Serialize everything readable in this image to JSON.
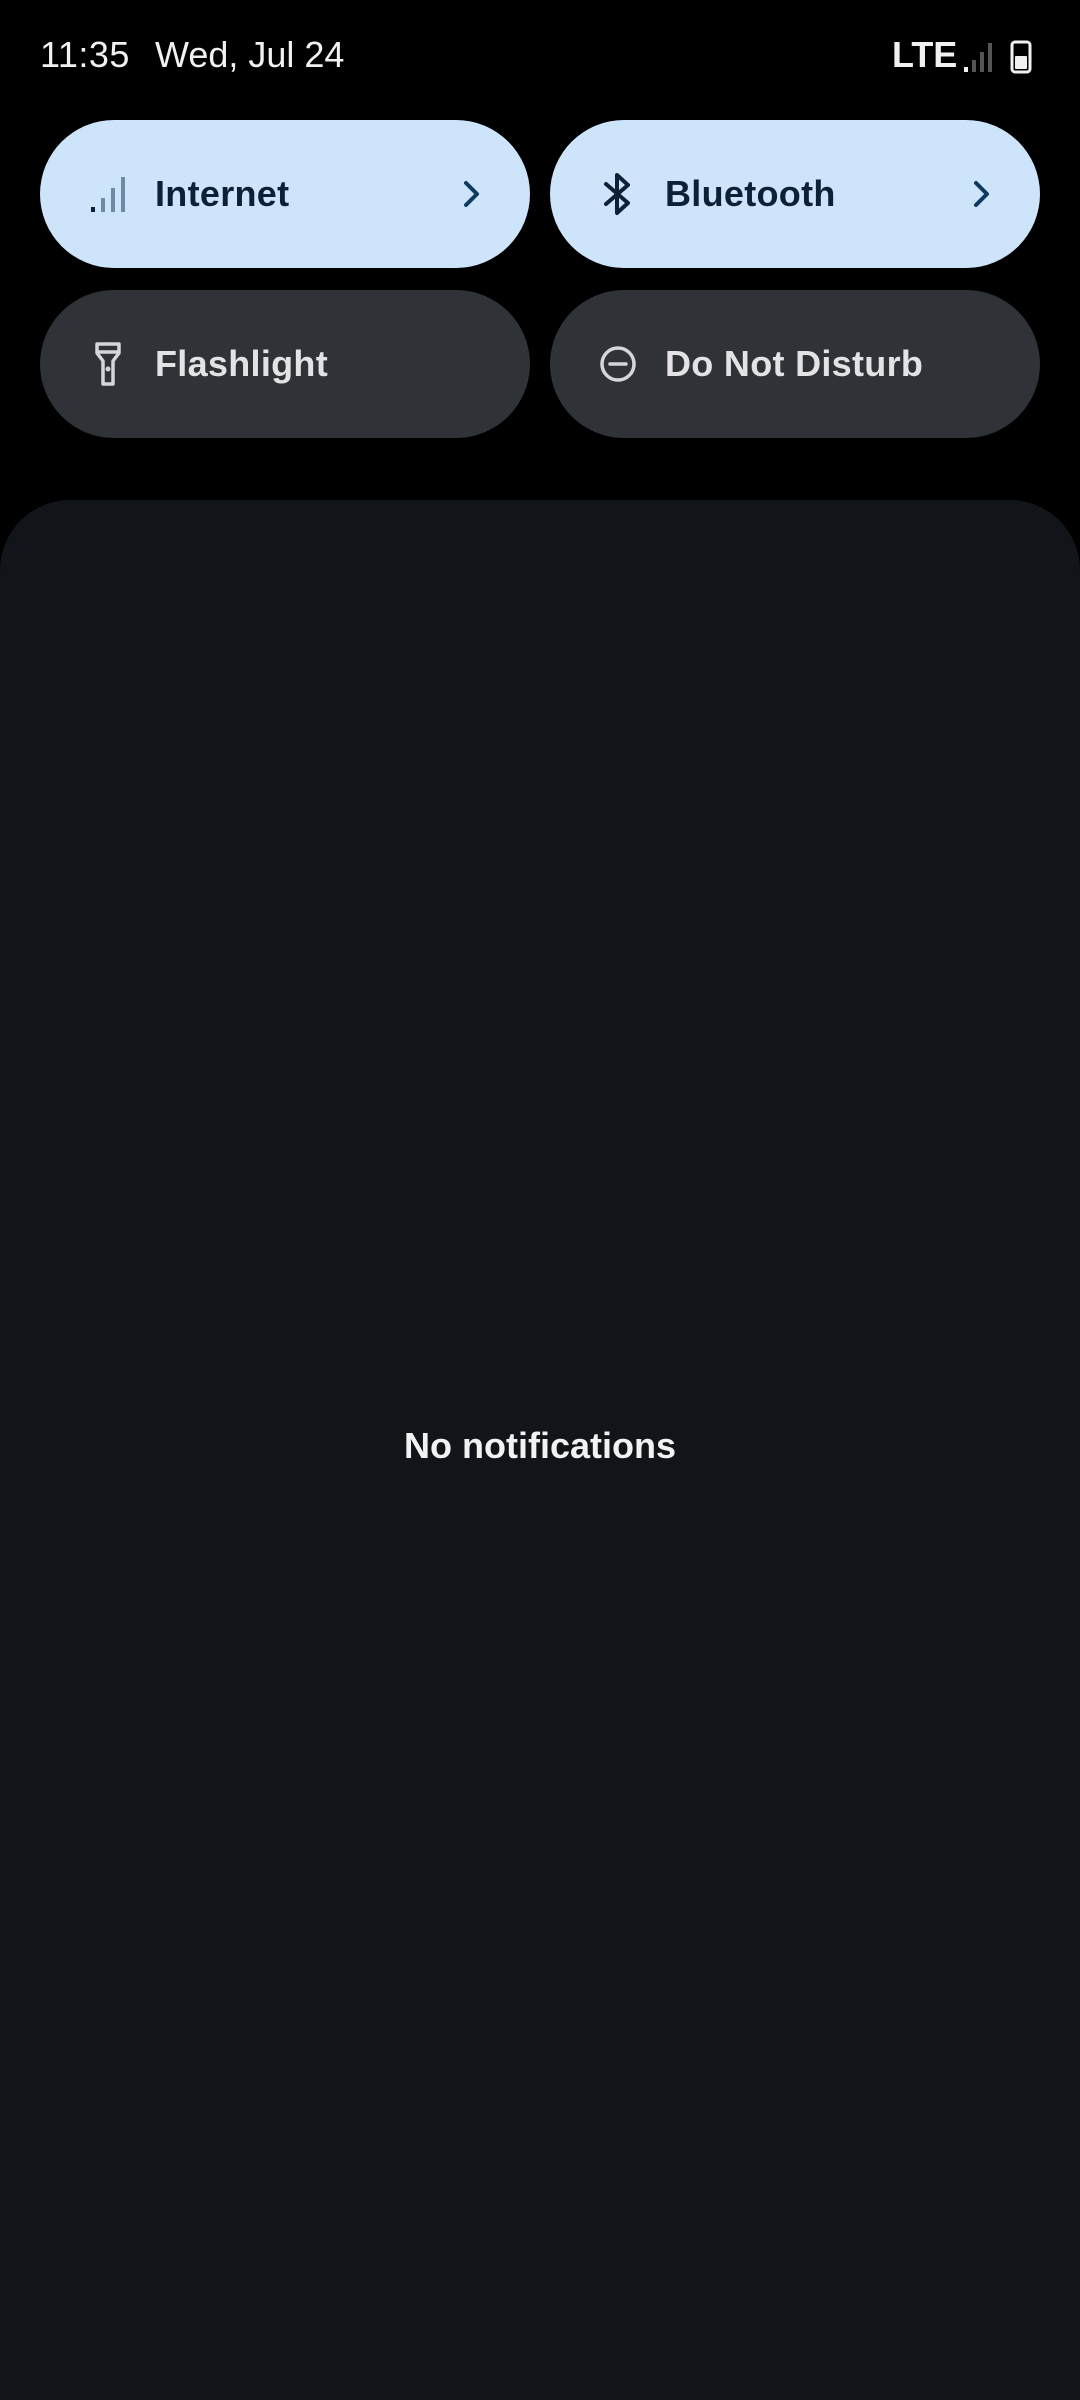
{
  "status_bar": {
    "time": "11:35",
    "date": "Wed, Jul 24",
    "network": "LTE",
    "signal_icon": "signal-icon",
    "battery_icon": "battery-icon"
  },
  "quick_settings": {
    "tiles": [
      {
        "label": "Internet",
        "state": "active",
        "icon": "cell-signal-icon",
        "has_chevron": true
      },
      {
        "label": "Bluetooth",
        "state": "active",
        "icon": "bluetooth-icon",
        "has_chevron": true
      },
      {
        "label": "Flashlight",
        "state": "inactive",
        "icon": "flashlight-icon",
        "has_chevron": false
      },
      {
        "label": "Do Not Disturb",
        "state": "inactive",
        "icon": "do-not-disturb-icon",
        "has_chevron": false
      }
    ]
  },
  "notifications": {
    "empty_text": "No notifications"
  },
  "colors": {
    "background": "#000000",
    "tile_active": "#cde4fa",
    "tile_inactive": "#2f3237",
    "panel": "#111419"
  }
}
